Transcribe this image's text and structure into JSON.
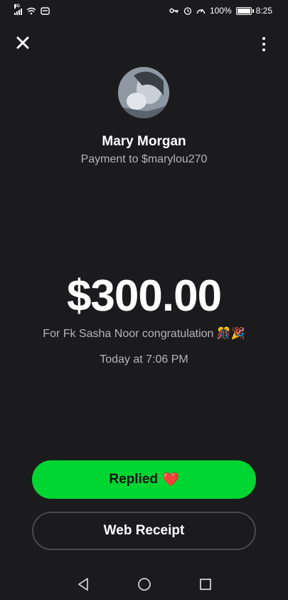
{
  "status_bar": {
    "network": "4G",
    "battery": "100%",
    "time": "8:25"
  },
  "top_bar": {
    "close_icon": "close-icon",
    "more_icon": "more-vertical-icon"
  },
  "payment": {
    "recipient_name": "Mary Morgan",
    "subtitle": "Payment to $marylou270",
    "amount": "$300.00",
    "note": "For Fk Sasha Noor congratulation 🎊🎉",
    "timestamp": "Today at 7:06 PM"
  },
  "actions": {
    "replied_label": "Replied",
    "replied_emoji": "❤️",
    "web_receipt_label": "Web Receipt"
  },
  "nav": {
    "back": "back-icon",
    "home": "home-icon",
    "recents": "recents-icon"
  },
  "colors": {
    "background": "#1b1b1d",
    "accent_green": "#00d632",
    "secondary_text": "#b5b5b8",
    "heart": "#e0242b"
  }
}
